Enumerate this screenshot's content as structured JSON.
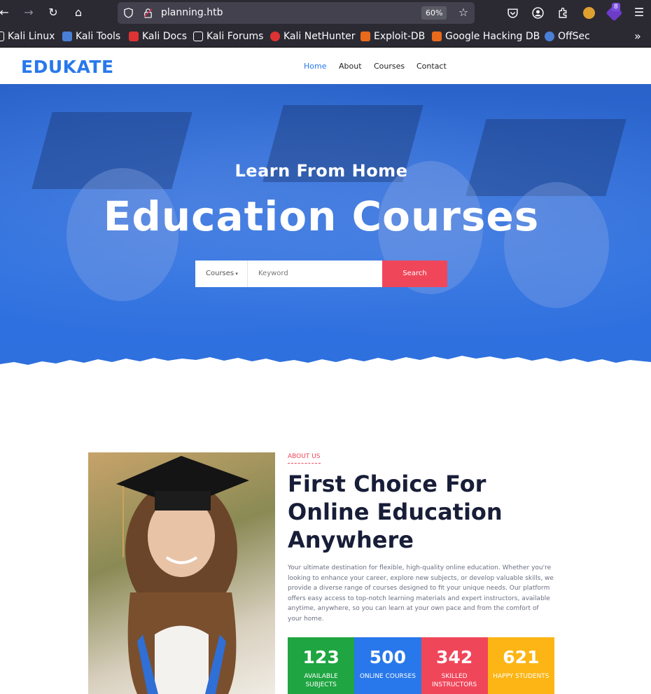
{
  "browser": {
    "url": "planning.htb",
    "zoom": "60%",
    "extension_badge": "8",
    "bookmarks": [
      {
        "label": "Kali Linux",
        "color": "#ffffff"
      },
      {
        "label": "Kali Tools",
        "color": "#4a7fd6"
      },
      {
        "label": "Kali Docs",
        "color": "#d33"
      },
      {
        "label": "Kali Forums",
        "color": "#ffffff"
      },
      {
        "label": "Kali NetHunter",
        "color": "#d33"
      },
      {
        "label": "Exploit-DB",
        "color": "#e86a1a"
      },
      {
        "label": "Google Hacking DB",
        "color": "#e86a1a"
      },
      {
        "label": "OffSec",
        "color": "#4a7fd6"
      }
    ]
  },
  "site": {
    "logo": "EDUKATE",
    "nav": [
      "Home",
      "About",
      "Courses",
      "Contact"
    ],
    "accent": "#2878eb",
    "cta_color": "#f0465a"
  },
  "hero": {
    "subtitle": "Learn From Home",
    "title": "Education Courses",
    "search": {
      "select_label": "Courses",
      "placeholder": "Keyword",
      "button": "Search"
    }
  },
  "about": {
    "kicker": "ABOUT US",
    "title": "First Choice For Online Education Anywhere",
    "text": "Your ultimate destination for flexible, high-quality online education. Whether you're looking to enhance your career, explore new subjects, or develop valuable skills, we provide a diverse range of courses designed to fit your unique needs. Our platform offers easy access to top-notch learning materials and expert instructors, available anytime, anywhere, so you can learn at your own pace and from the comfort of your home.",
    "stats": [
      {
        "value": "123",
        "label": "Available Subjects",
        "color": "#1fa541"
      },
      {
        "value": "500",
        "label": "Online Courses",
        "color": "#2878eb"
      },
      {
        "value": "342",
        "label": "Skilled Instructors",
        "color": "#f0465a"
      },
      {
        "value": "621",
        "label": "Happy Students",
        "color": "#fcb514"
      }
    ]
  }
}
